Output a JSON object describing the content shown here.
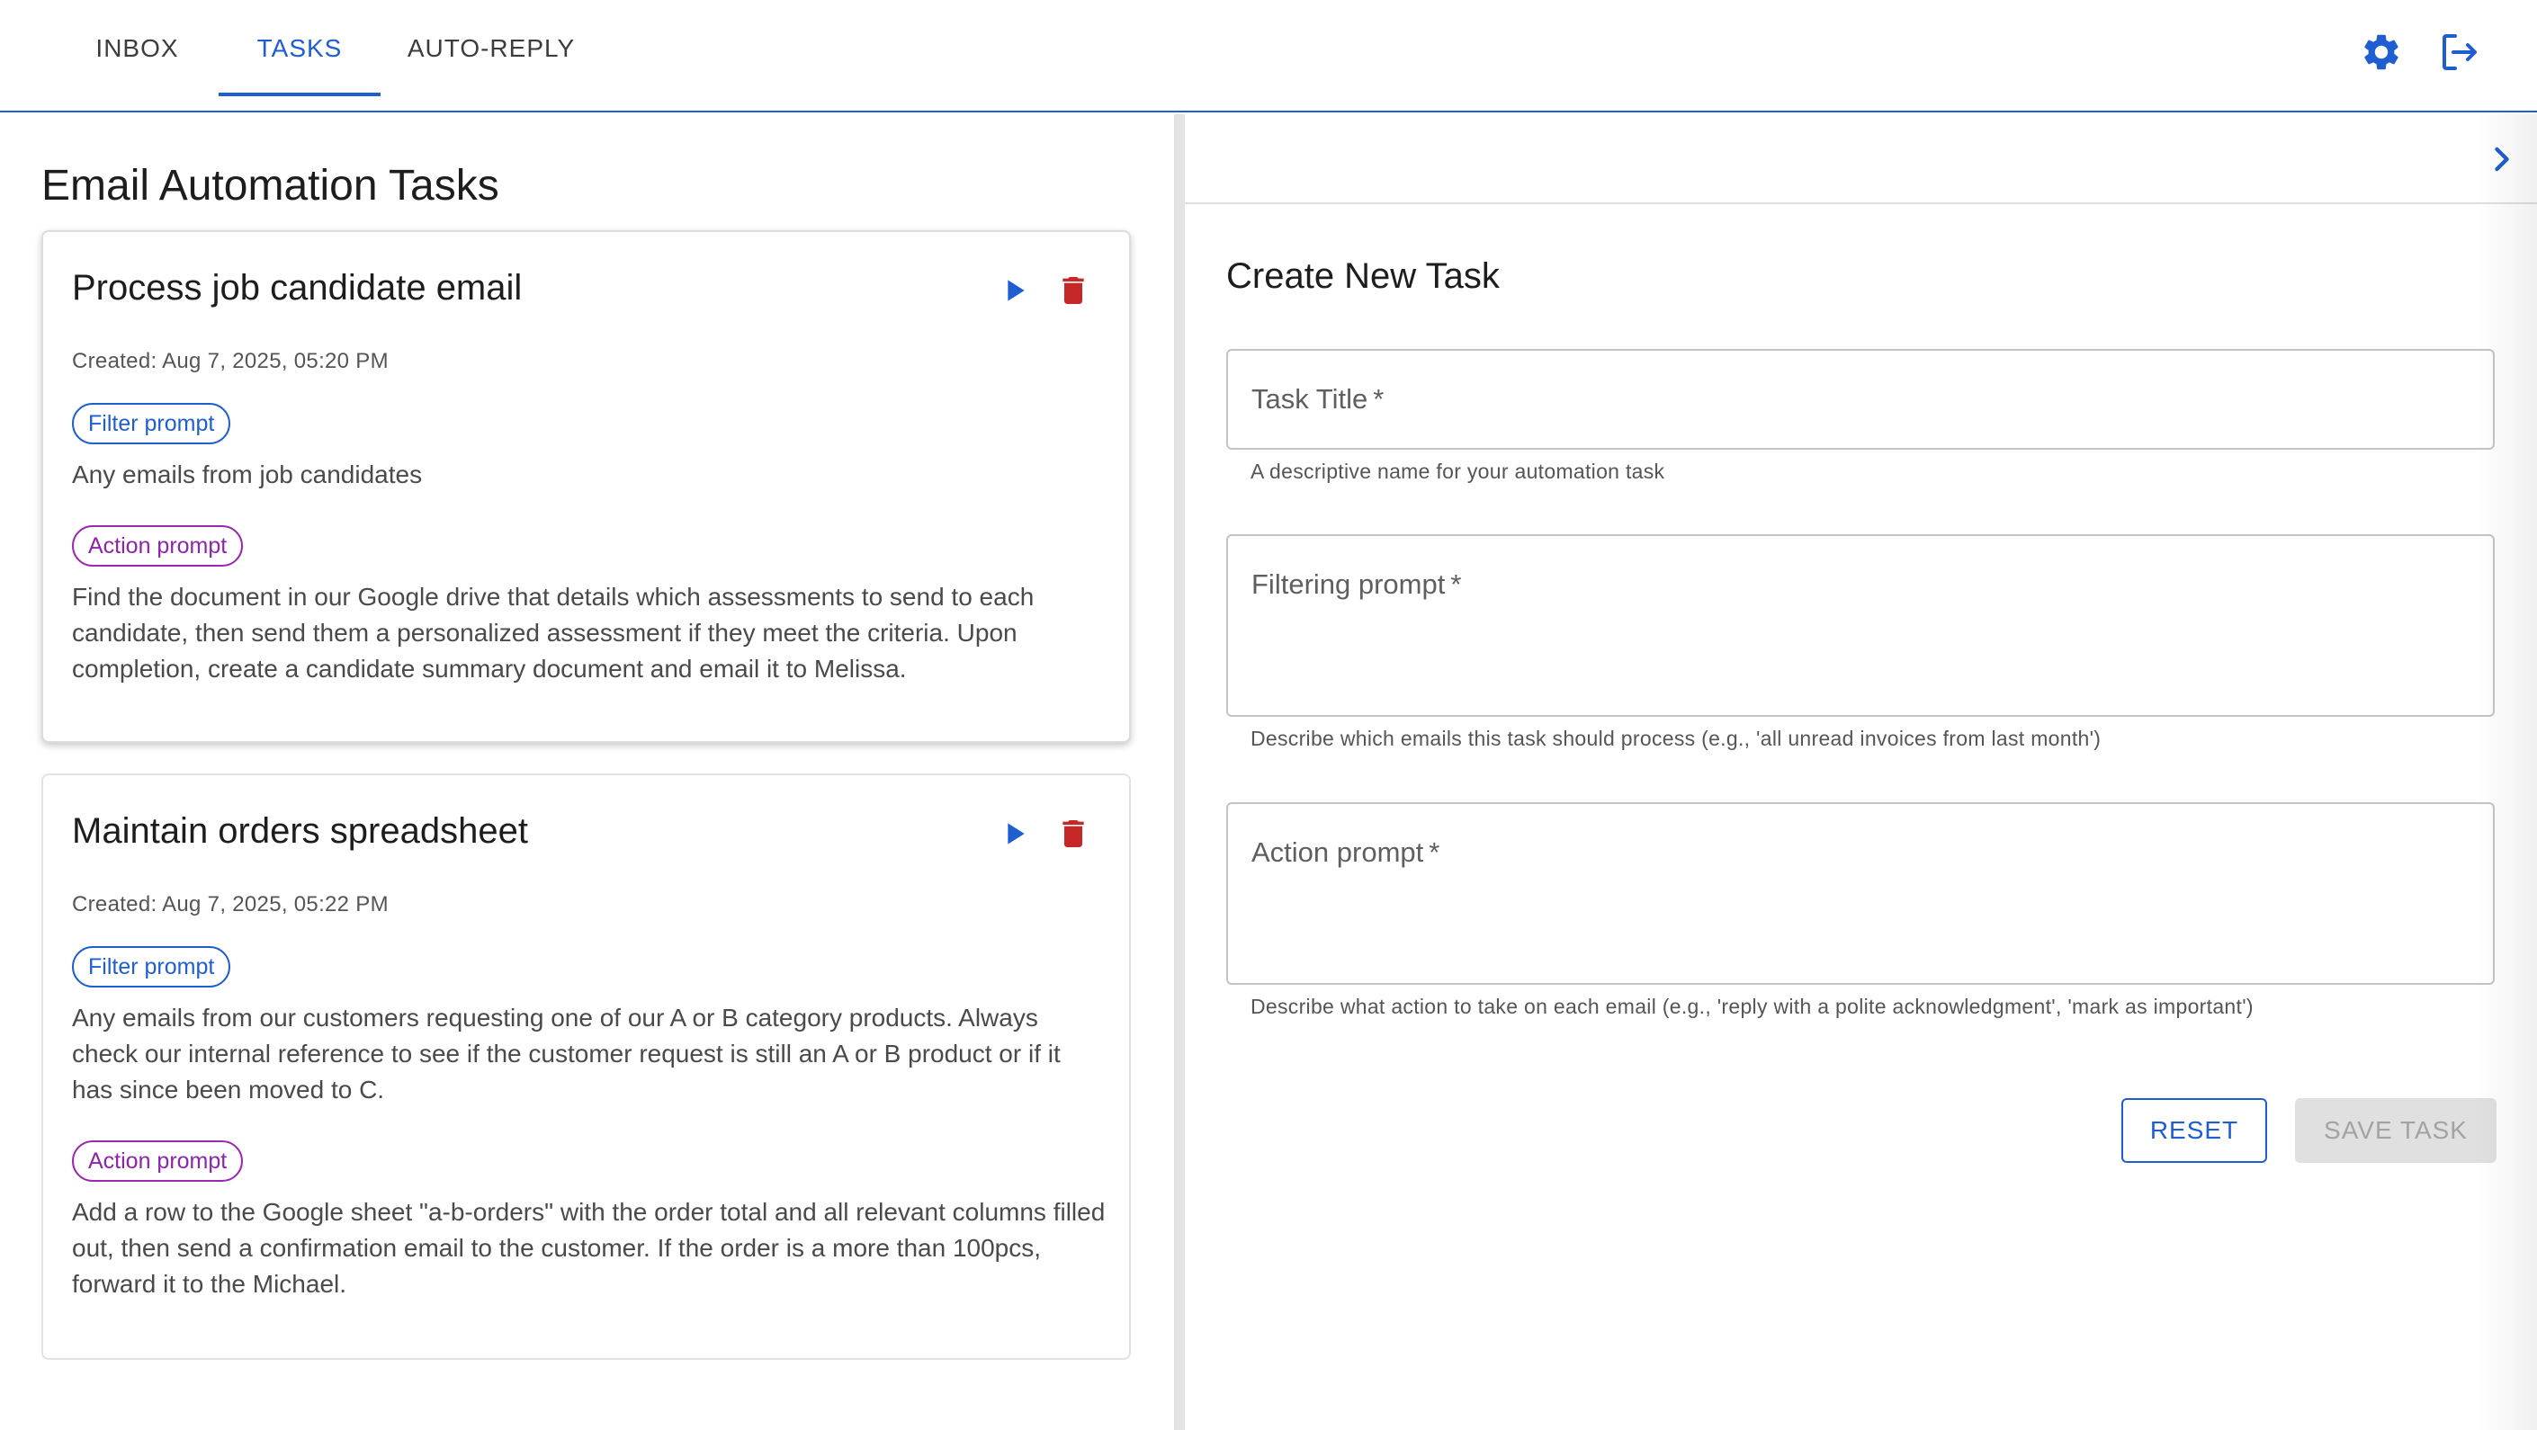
{
  "nav": {
    "tabs": [
      {
        "label": "INBOX",
        "active": false
      },
      {
        "label": "TASKS",
        "active": true
      },
      {
        "label": "AUTO-REPLY",
        "active": false
      }
    ],
    "icons": {
      "settings": "gear-icon",
      "logout": "logout-icon"
    }
  },
  "tasks_panel": {
    "title": "Email Automation Tasks",
    "tasks": [
      {
        "title": "Process job candidate email",
        "created": "Created: Aug 7, 2025, 05:20 PM",
        "filter_label": "Filter prompt",
        "filter_text": "Any emails from job candidates",
        "action_label": "Action prompt",
        "action_text": "Find the document in our Google drive that details which assessments to send to each candidate, then send them a personalized assessment if they meet the criteria. Upon completion, create a candidate summary document and email it to Melissa."
      },
      {
        "title": "Maintain orders spreadsheet",
        "created": "Created: Aug 7, 2025, 05:22 PM",
        "filter_label": "Filter prompt",
        "filter_text": "Any emails from our customers requesting one of our A or B category products. Always check our internal reference to see if the customer request is still an A or B product or if it has since been moved to C.",
        "action_label": "Action prompt",
        "action_text": "Add a row to the Google sheet \"a-b-orders\" with the order total and all relevant columns filled out, then send a confirmation email to the customer. If the order is a more than 100pcs, forward it to the Michael."
      }
    ]
  },
  "form": {
    "title": "Create New Task",
    "fields": [
      {
        "label": "Task Title",
        "required_mark": "*",
        "value": "",
        "helper": "A descriptive name for your automation task"
      },
      {
        "label": "Filtering prompt",
        "required_mark": "*",
        "value": "",
        "helper": "Describe which emails this task should process (e.g., 'all unread invoices from last month')"
      },
      {
        "label": "Action prompt",
        "required_mark": "*",
        "value": "",
        "helper": "Describe what action to take on each email (e.g., 'reply with a polite acknowledgment', 'mark as important')"
      }
    ],
    "reset_label": "RESET",
    "save_label": "SAVE TASK",
    "save_enabled": false
  },
  "colors": {
    "accent": "#1e5ed1",
    "delete": "#c62828",
    "action_chip": "#9c27b0"
  }
}
